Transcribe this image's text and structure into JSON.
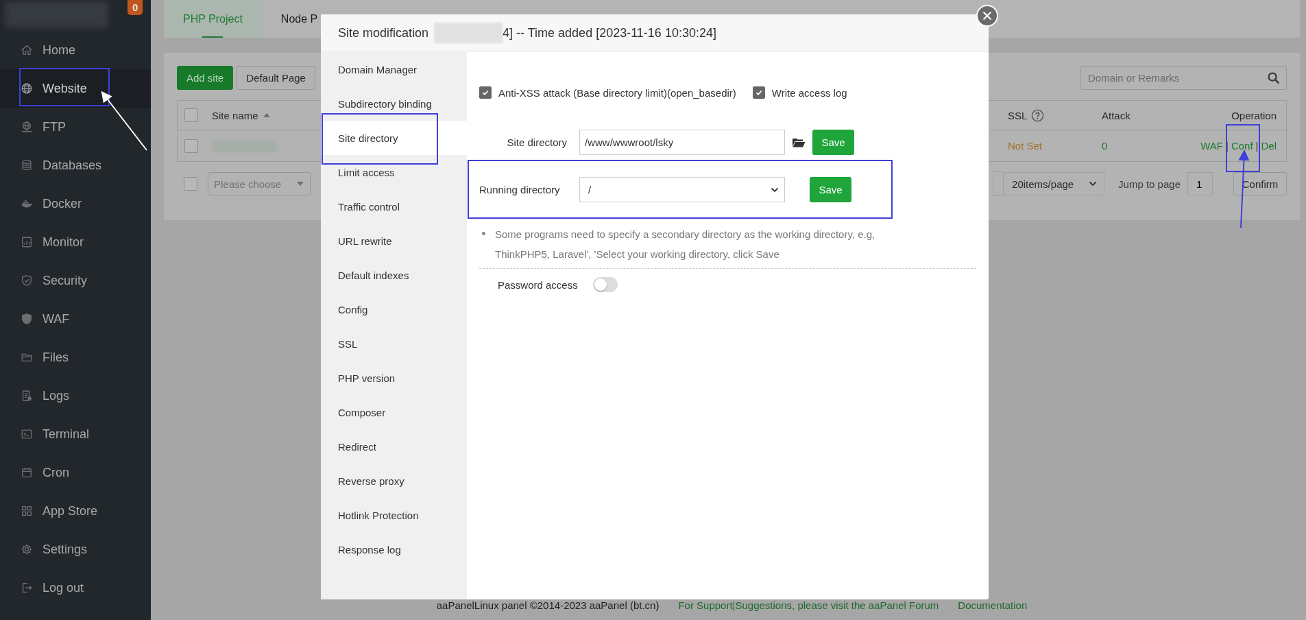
{
  "sidebar": {
    "badge": "0",
    "items": [
      {
        "label": "Home",
        "selected": false
      },
      {
        "label": "Website",
        "selected": true
      },
      {
        "label": "FTP",
        "selected": false
      },
      {
        "label": "Databases",
        "selected": false
      },
      {
        "label": "Docker",
        "selected": false
      },
      {
        "label": "Monitor",
        "selected": false
      },
      {
        "label": "Security",
        "selected": false
      },
      {
        "label": "WAF",
        "selected": false
      },
      {
        "label": "Files",
        "selected": false
      },
      {
        "label": "Logs",
        "selected": false
      },
      {
        "label": "Terminal",
        "selected": false
      },
      {
        "label": "Cron",
        "selected": false
      },
      {
        "label": "App Store",
        "selected": false
      },
      {
        "label": "Settings",
        "selected": false
      },
      {
        "label": "Log out",
        "selected": false
      }
    ]
  },
  "tabs": [
    {
      "label": "PHP Project",
      "selected": true
    },
    {
      "label": "Node P",
      "selected": false
    }
  ],
  "toolbar": {
    "buttons": [
      {
        "label": "Add site",
        "kind": "primary"
      },
      {
        "label": "Default Page",
        "kind": "default"
      }
    ],
    "search": {
      "placeholder": "Domain or Remarks"
    }
  },
  "table": {
    "select_all_checked": false,
    "columns": [
      {
        "label": "Site name",
        "kind": "sort"
      },
      {
        "label": "SSL",
        "kind": "help"
      },
      {
        "label": "Attack",
        "kind": "plain"
      },
      {
        "label": "Operation",
        "kind": "plain"
      }
    ],
    "rows": [
      {
        "checked": false,
        "ssl": "Not Set",
        "attack": "0",
        "actions": [
          "WAF",
          "Conf",
          "Del"
        ],
        "action_separator": "|"
      }
    ]
  },
  "pagination": {
    "checked": false,
    "batch_select": {
      "placeholder": "Please choose"
    },
    "page_size": "20items/page",
    "jump_label": "Jump to page",
    "page": "1",
    "confirm": "Confirm"
  },
  "modal": {
    "title": "Site modification",
    "title_rest": "4] -- Time added [2023-11-16 10:30:24]",
    "nav": [
      {
        "label": "Domain Manager",
        "selected": false
      },
      {
        "label": "Subdirectory binding",
        "selected": false
      },
      {
        "label": "Site directory",
        "selected": true
      },
      {
        "label": "Limit access",
        "selected": false
      },
      {
        "label": "Traffic control",
        "selected": false
      },
      {
        "label": "URL rewrite",
        "selected": false
      },
      {
        "label": "Default indexes",
        "selected": false
      },
      {
        "label": "Config",
        "selected": false
      },
      {
        "label": "SSL",
        "selected": false
      },
      {
        "label": "PHP version",
        "selected": false
      },
      {
        "label": "Composer",
        "selected": false
      },
      {
        "label": "Redirect",
        "selected": false
      },
      {
        "label": "Reverse proxy",
        "selected": false
      },
      {
        "label": "Hotlink Protection",
        "selected": false
      },
      {
        "label": "Response log",
        "selected": false
      }
    ],
    "options": [
      {
        "label": "Anti-XSS attack (Base directory limit)(open_basedir)",
        "checked": true
      },
      {
        "label": "Write access log",
        "checked": true
      }
    ],
    "site_directory": {
      "label": "Site directory",
      "value": "/www/wwwroot/lsky",
      "button": "Save"
    },
    "running_directory": {
      "label": "Running directory",
      "value": "/",
      "button": "Save"
    },
    "note": "Some programs need to specify a secondary directory as the working directory, e.g, ThinkPHP5, Laravel', 'Select your working directory, click Save",
    "password_access": {
      "label": "Password access",
      "on": false
    }
  },
  "footer": {
    "copyright": "aaPanelLinux panel ©2014-2023 aaPanel (bt.cn)",
    "support_link": "For Support|Suggestions, please visit the aaPanel Forum",
    "docs_link": "Documentation"
  }
}
